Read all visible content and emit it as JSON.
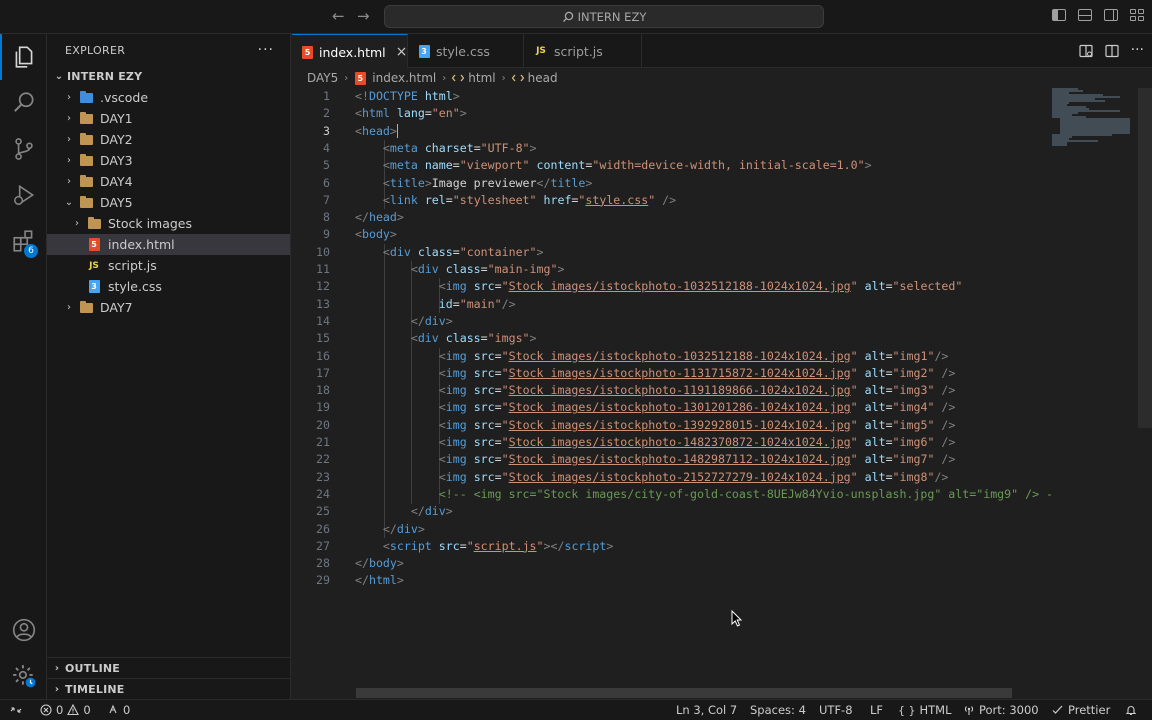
{
  "titlebar": {
    "search_text": "INTERN EZY",
    "back": "←",
    "forward": "→"
  },
  "activitybar": {
    "extensions_badge": "6"
  },
  "sidebar": {
    "title": "EXPLORER",
    "more": "···",
    "root": "INTERN EZY",
    "items": [
      {
        "label": ".vscode",
        "chev": "›",
        "icon": "folder-vscode"
      },
      {
        "label": "DAY1",
        "chev": "›",
        "icon": "folder"
      },
      {
        "label": "DAY2",
        "chev": "›",
        "icon": "folder"
      },
      {
        "label": "DAY3",
        "chev": "›",
        "icon": "folder"
      },
      {
        "label": "DAY4",
        "chev": "›",
        "icon": "folder"
      },
      {
        "label": "DAY5",
        "chev": "⌄",
        "icon": "folder-open"
      },
      {
        "label": "Stock images",
        "chev": "›",
        "icon": "folder"
      },
      {
        "label": "index.html",
        "icon": "html"
      },
      {
        "label": "script.js",
        "icon": "js"
      },
      {
        "label": "style.css",
        "icon": "css"
      },
      {
        "label": "DAY7",
        "chev": "›",
        "icon": "folder"
      }
    ],
    "outline": "OUTLINE",
    "timeline": "TIMELINE"
  },
  "tabs": [
    {
      "label": "index.html",
      "close": "×"
    },
    {
      "label": "style.css"
    },
    {
      "label": "script.js"
    }
  ],
  "icon_letters": {
    "js": "JS",
    "css": "3",
    "html": "5"
  },
  "breadcrumb": [
    "DAY5",
    "index.html",
    "html",
    "head"
  ],
  "editor": {
    "line_numbers": [
      "1",
      "2",
      "3",
      "4",
      "5",
      "6",
      "7",
      "8",
      "9",
      "10",
      "11",
      "12",
      "13",
      "14",
      "15",
      "16",
      "17",
      "18",
      "19",
      "20",
      "21",
      "22",
      "23",
      "24",
      "25",
      "26",
      "27",
      "28",
      "29"
    ],
    "current_line": 3
  },
  "statusbar": {
    "errors": "0",
    "warnings": "0",
    "ports": "0",
    "position": "Ln 3, Col 7",
    "spaces": "Spaces: 4",
    "encoding": "UTF-8",
    "eol": "LF",
    "language": "HTML",
    "port": "Port: 3000",
    "formatter": "Prettier"
  },
  "colors": {
    "accent": "#0078d4",
    "tag": "#569cd6",
    "attr": "#9cdcfe",
    "string": "#ce9178",
    "comment": "#6a9955"
  }
}
